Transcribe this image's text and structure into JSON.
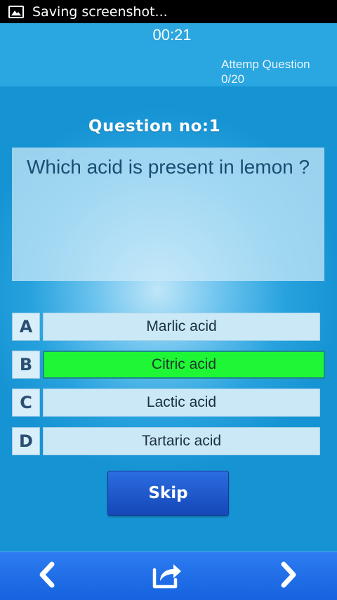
{
  "status_bar": {
    "text": "Saving screenshot..."
  },
  "quiz": {
    "timer": "00:21",
    "attempt_label": "Attemp Question",
    "attempt_count": "0/20",
    "question_number": "Question no:1",
    "question_text": "Which acid is present in lemon ?",
    "options": [
      {
        "letter": "A",
        "text": "Marlic acid"
      },
      {
        "letter": "B",
        "text": "Citric acid"
      },
      {
        "letter": "C",
        "text": "Lactic acid"
      },
      {
        "letter": "D",
        "text": "Tartaric acid"
      }
    ],
    "selected_option": "B",
    "skip_label": "Skip"
  },
  "bottom_nav": {
    "icons": [
      "chevron-left-icon",
      "share-icon",
      "chevron-right-icon"
    ]
  },
  "colors": {
    "background": "#1a9ad8",
    "correct_answer": "#1ef636",
    "skip_button": "#1e5bd0",
    "bottom_nav": "#1f6fe8"
  }
}
